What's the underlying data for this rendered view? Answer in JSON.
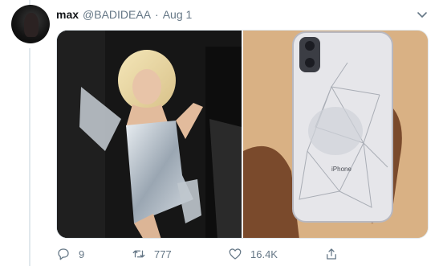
{
  "tweet": {
    "author_name": "max",
    "handle": "@BADIDEAA",
    "separator": "·",
    "date": "Aug 1",
    "images": [
      {
        "description_icon": "photo-dress-icon"
      },
      {
        "description_icon": "photo-cracked-phone-icon",
        "phone_brand_text": "iPhone"
      }
    ]
  },
  "actions": {
    "reply_count": "9",
    "retweet_count": "777",
    "like_count": "16.4K"
  },
  "colors": {
    "text_primary": "#14171a",
    "text_secondary": "#657786",
    "border": "#e1e8ed"
  }
}
